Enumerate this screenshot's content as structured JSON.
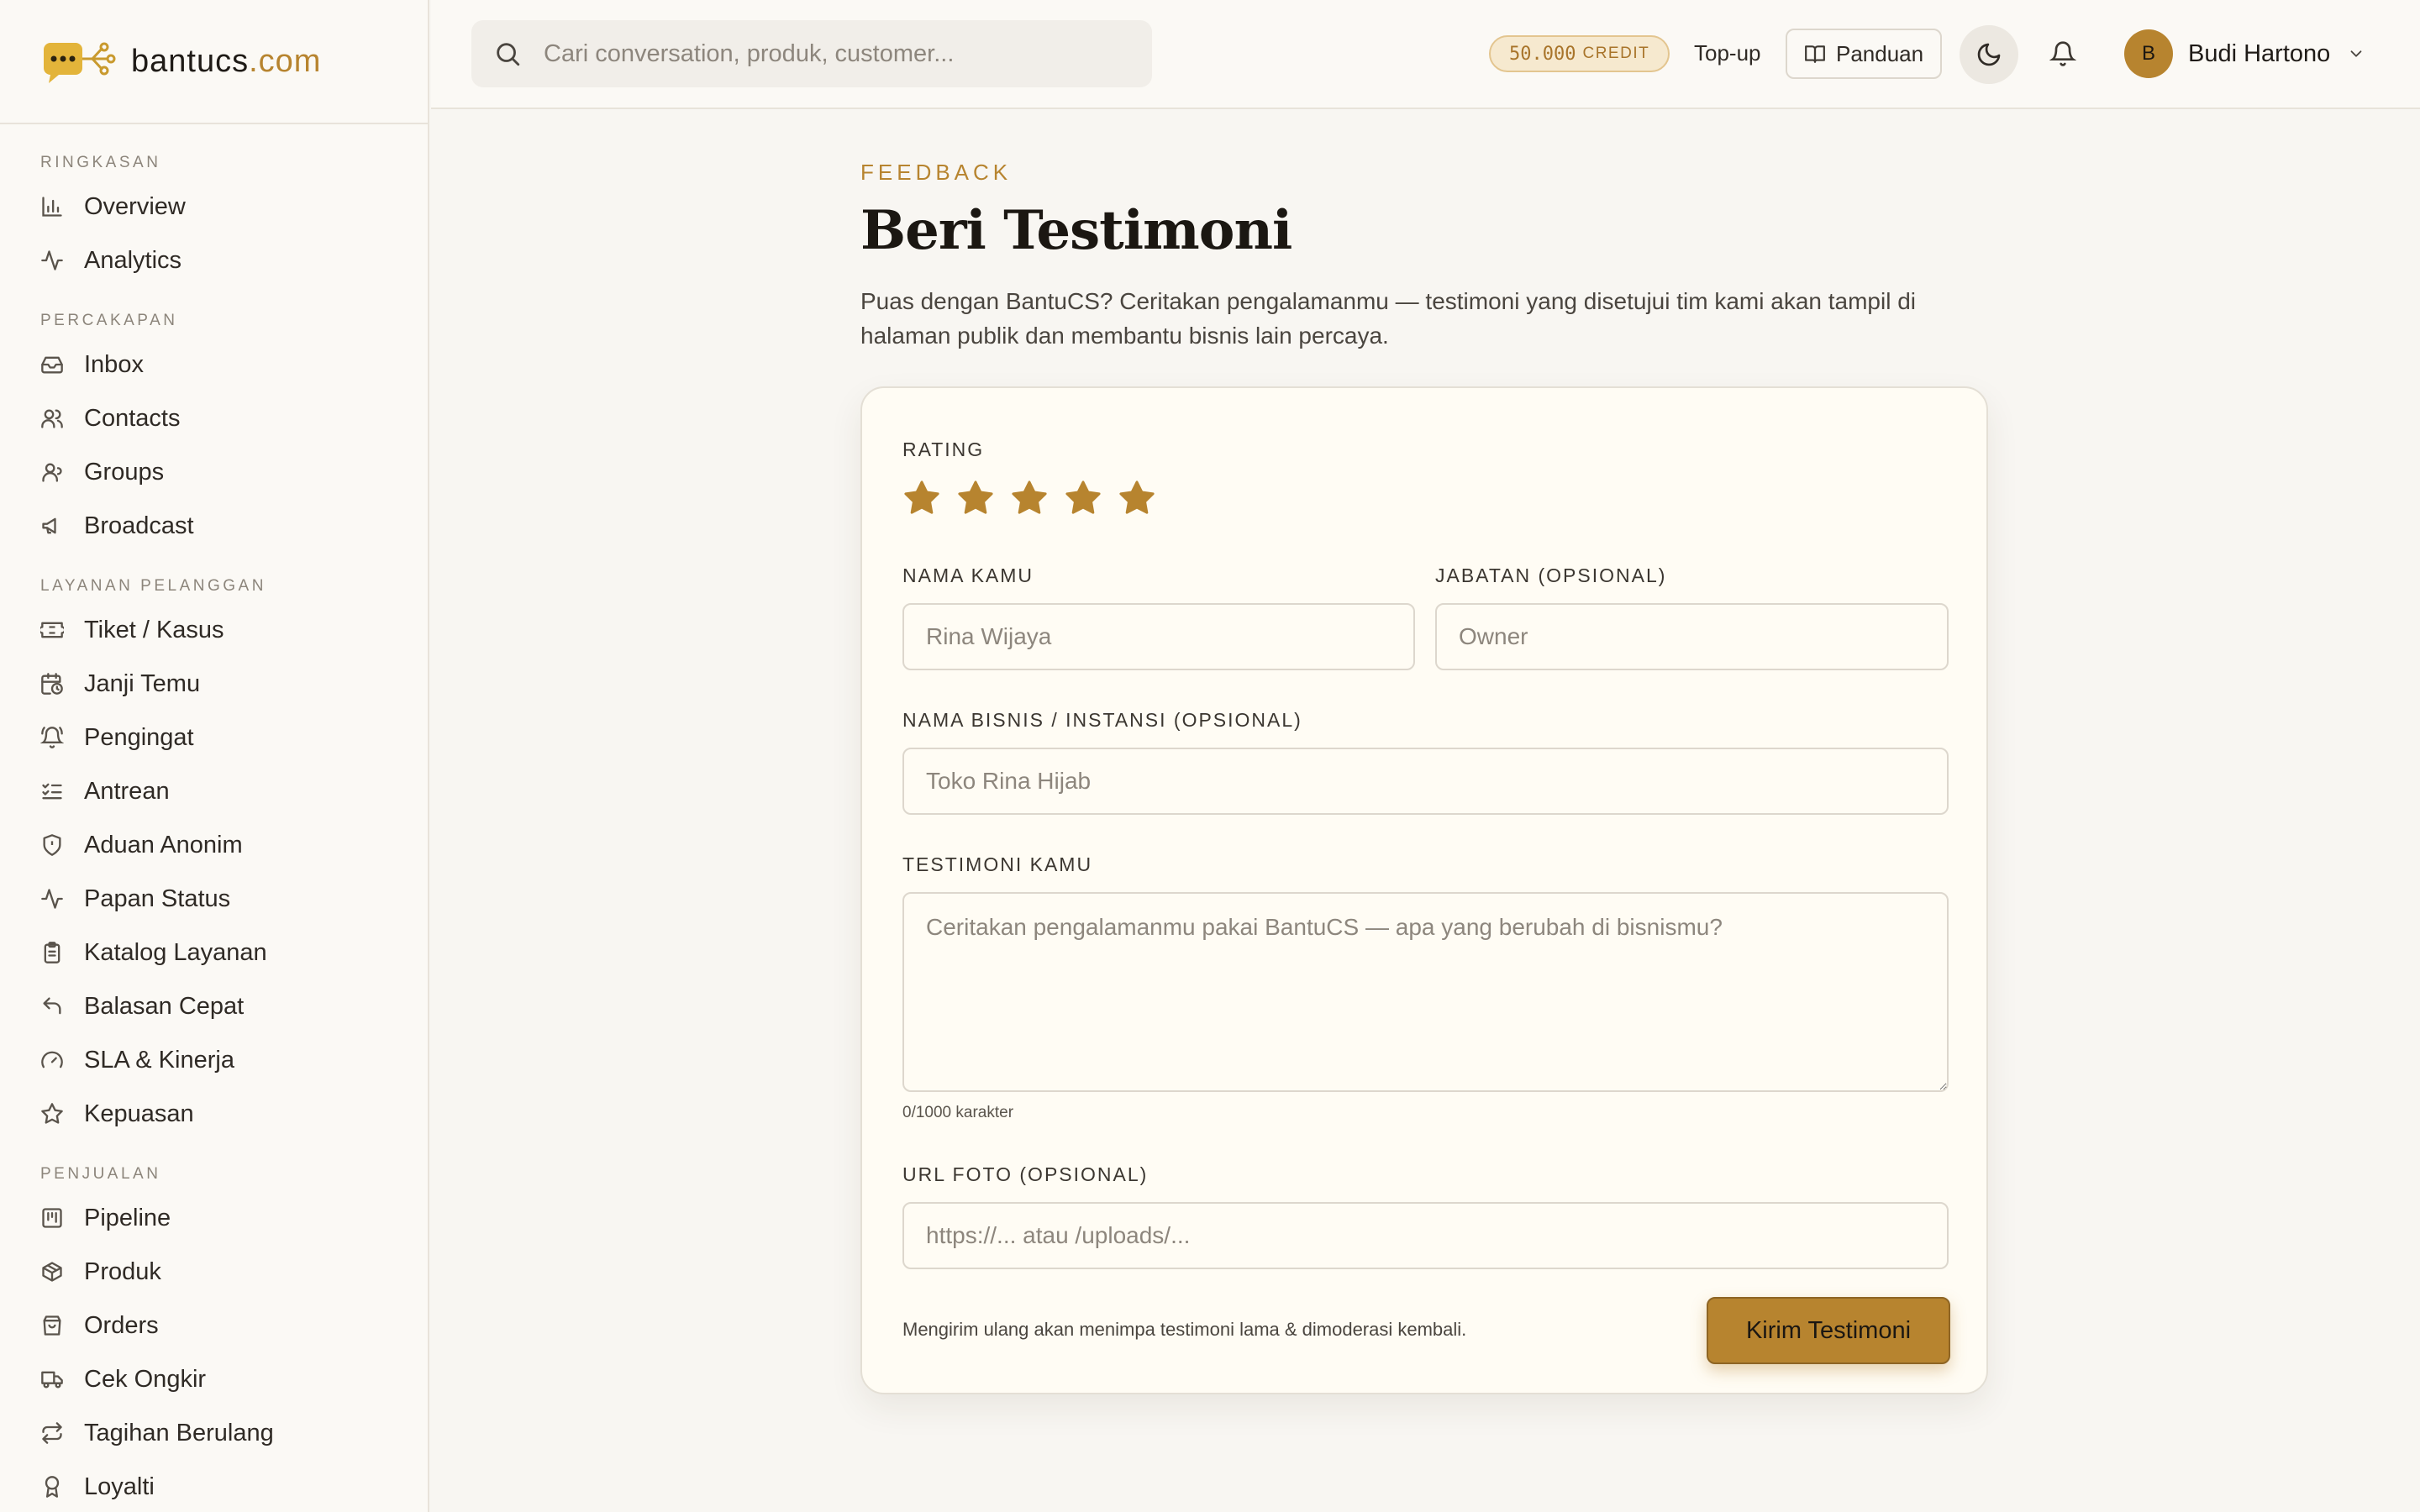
{
  "brand": {
    "name": "bantucs",
    "tld": ".com"
  },
  "sidebar": {
    "sections": [
      {
        "label": "Ringkasan",
        "items": [
          {
            "label": "Overview",
            "icon": "bar-chart-icon"
          },
          {
            "label": "Analytics",
            "icon": "activity-icon"
          }
        ]
      },
      {
        "label": "Percakapan",
        "items": [
          {
            "label": "Inbox",
            "icon": "inbox-icon"
          },
          {
            "label": "Contacts",
            "icon": "users-icon"
          },
          {
            "label": "Groups",
            "icon": "users-group-icon"
          },
          {
            "label": "Broadcast",
            "icon": "megaphone-icon"
          }
        ]
      },
      {
        "label": "Layanan Pelanggan",
        "items": [
          {
            "label": "Tiket / Kasus",
            "icon": "ticket-icon"
          },
          {
            "label": "Janji Temu",
            "icon": "calendar-clock-icon"
          },
          {
            "label": "Pengingat",
            "icon": "bell-ring-icon"
          },
          {
            "label": "Antrean",
            "icon": "list-checks-icon"
          },
          {
            "label": "Aduan Anonim",
            "icon": "shield-icon"
          },
          {
            "label": "Papan Status",
            "icon": "activity-icon"
          },
          {
            "label": "Katalog Layanan",
            "icon": "clipboard-icon"
          },
          {
            "label": "Balasan Cepat",
            "icon": "reply-icon"
          },
          {
            "label": "SLA & Kinerja",
            "icon": "gauge-icon"
          },
          {
            "label": "Kepuasan",
            "icon": "star-icon"
          }
        ]
      },
      {
        "label": "Penjualan",
        "items": [
          {
            "label": "Pipeline",
            "icon": "kanban-icon"
          },
          {
            "label": "Produk",
            "icon": "package-icon"
          },
          {
            "label": "Orders",
            "icon": "shopping-bag-icon"
          },
          {
            "label": "Cek Ongkir",
            "icon": "truck-icon"
          },
          {
            "label": "Tagihan Berulang",
            "icon": "repeat-icon"
          },
          {
            "label": "Loyalti",
            "icon": "award-icon"
          }
        ]
      }
    ]
  },
  "topbar": {
    "search_placeholder": "Cari conversation, produk, customer...",
    "credit_amount": "50.000",
    "credit_unit": "CREDIT",
    "topup_label": "Top-up",
    "guide_label": "Panduan",
    "user": {
      "initial": "B",
      "name": "Budi Hartono"
    }
  },
  "main": {
    "eyebrow": "Feedback",
    "title": "Beri Testimoni",
    "intro": "Puas dengan BantuCS? Ceritakan pengalamanmu — testimoni yang disetujui tim kami akan tampil di halaman publik dan membantu bisnis lain percaya."
  },
  "form": {
    "rating_label": "Rating",
    "rating_value": 5,
    "rating_max": 5,
    "name_label": "Nama Kamu",
    "name_placeholder": "Rina Wijaya",
    "title_label": "Jabatan (Opsional)",
    "title_placeholder": "Owner",
    "business_label": "Nama Bisnis / Instansi (Opsional)",
    "business_placeholder": "Toko Rina Hijab",
    "testimonial_label": "Testimoni Kamu",
    "testimonial_placeholder": "Ceritakan pengalamanmu pakai BantuCS — apa yang berubah di bisnismu?",
    "counter": "0/1000 karakter",
    "photo_label": "URL Foto (Opsional)",
    "photo_placeholder": "https://... atau /uploads/...",
    "note": "Mengirim ulang akan menimpa testimoni lama & dimoderasi kembali.",
    "submit_label": "Kirim Testimoni"
  },
  "colors": {
    "accent": "#b7842f",
    "background": "#f8f6f2",
    "card": "#fffcf4"
  }
}
